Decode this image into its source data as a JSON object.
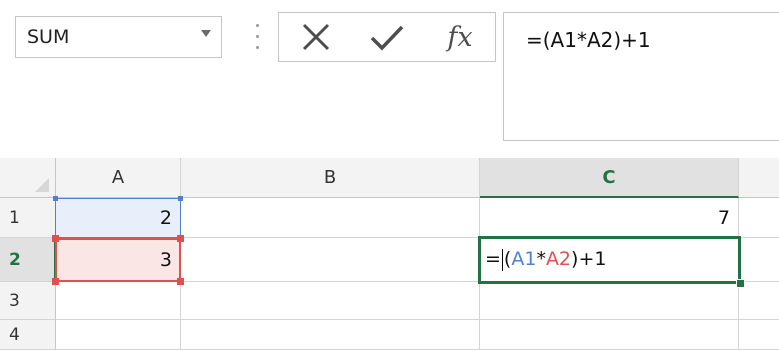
{
  "name_box": {
    "value": "SUM"
  },
  "formula_bar": {
    "cancel_label": "✕",
    "enter_label": "✓",
    "function_label": "fx",
    "formula": "=(A1*A2)+1"
  },
  "columns": [
    "A",
    "B",
    "C"
  ],
  "rows": [
    "1",
    "2",
    "3",
    "4"
  ],
  "cells": {
    "A1": "2",
    "A2": "3",
    "C1": "7"
  },
  "edit_cell": {
    "prefix": "=",
    "open": "(",
    "ref1": "A1",
    "op": "*",
    "ref2": "A2",
    "suffix": ")+1"
  },
  "colors": {
    "active_green": "#217346",
    "ref_blue": "#4f81d1",
    "ref_red": "#e0504f"
  }
}
